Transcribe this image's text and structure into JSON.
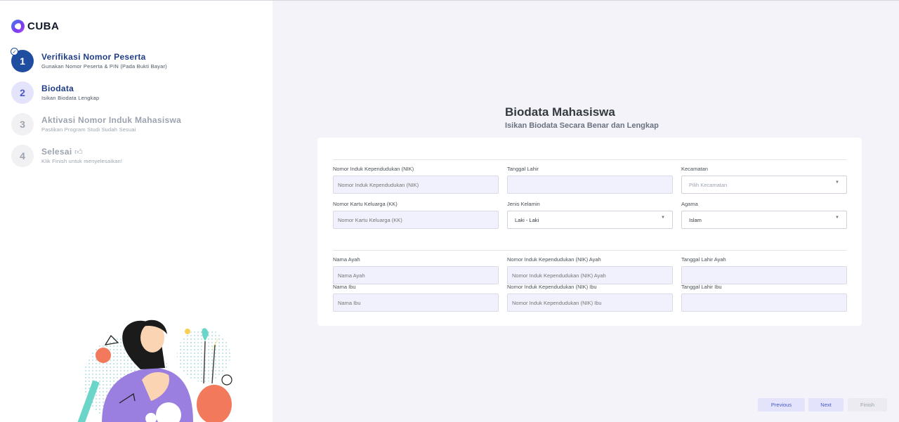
{
  "app": {
    "brand": "CUBA"
  },
  "steps": [
    {
      "num": "1",
      "title": "Verifikasi Nomor Peserta",
      "subtitle": "Gunakan Nomor Peserta & PIN (Pada Bukti Bayar)",
      "done_mark": "✓"
    },
    {
      "num": "2",
      "title": "Biodata",
      "subtitle": "Isikan Biodata Lengkap"
    },
    {
      "num": "3",
      "title": "Aktivasi Nomor Induk Mahasiswa",
      "subtitle": "Pastikan Program Studi Sudah Sesuai"
    },
    {
      "num": "4",
      "title": "Selesai",
      "title_icon": "thumbs-up-icon",
      "subtitle": "Klik Finish untuk menyelesaikan!"
    }
  ],
  "form": {
    "title": "Biodata Mahasiswa",
    "subtitle": "Isikan Biodata Secara Benar dan Lengkap",
    "nik": {
      "label": "Nomor Induk Kependudukan (NIK)",
      "placeholder": "Nomor Induk Kependudukan (NIK)",
      "value": ""
    },
    "tanggal_lahir": {
      "label": "Tanggal Lahir",
      "placeholder": "",
      "value": ""
    },
    "kecamatan": {
      "label": "Kecamatan",
      "value": "Pilih Kecamatan"
    },
    "kk": {
      "label": "Nomor Kartu Keluarga (KK)",
      "placeholder": "Nomor Kartu Keluarga (KK)",
      "value": ""
    },
    "jenis_kelamin": {
      "label": "Jenis Kelamin",
      "value": "Laki - Laki"
    },
    "agama": {
      "label": "Agama",
      "value": "Islam"
    },
    "nama_ayah": {
      "label": "Nama Ayah",
      "placeholder": "Nama Ayah",
      "value": ""
    },
    "nik_ayah": {
      "label": "Nomor Induk Kependudukan (NIK) Ayah",
      "placeholder": "Nomor Induk Kependudukan (NIK) Ayah",
      "value": ""
    },
    "tgl_lahir_ayah": {
      "label": "Tanggal Lahir Ayah",
      "placeholder": "",
      "value": ""
    },
    "nama_ibu": {
      "label": "Nama Ibu",
      "placeholder": "Nama Ibu",
      "value": ""
    },
    "nik_ibu": {
      "label": "Nomor Induk Kependudukan (NIK) Ibu",
      "placeholder": "Nomor Induk Kependudukan (NIK) Ibu",
      "value": ""
    },
    "tgl_lahir_ibu": {
      "label": "Tanggal Lahir Ibu",
      "placeholder": "",
      "value": ""
    }
  },
  "buttons": {
    "previous": "Previous",
    "next": "Next",
    "finish": "Finish"
  },
  "colors": {
    "primary": "#1f4ea1",
    "soft_primary": "#e3e4fb",
    "input_bg": "#f1f1fd",
    "page_bg": "#f3f3f9"
  }
}
